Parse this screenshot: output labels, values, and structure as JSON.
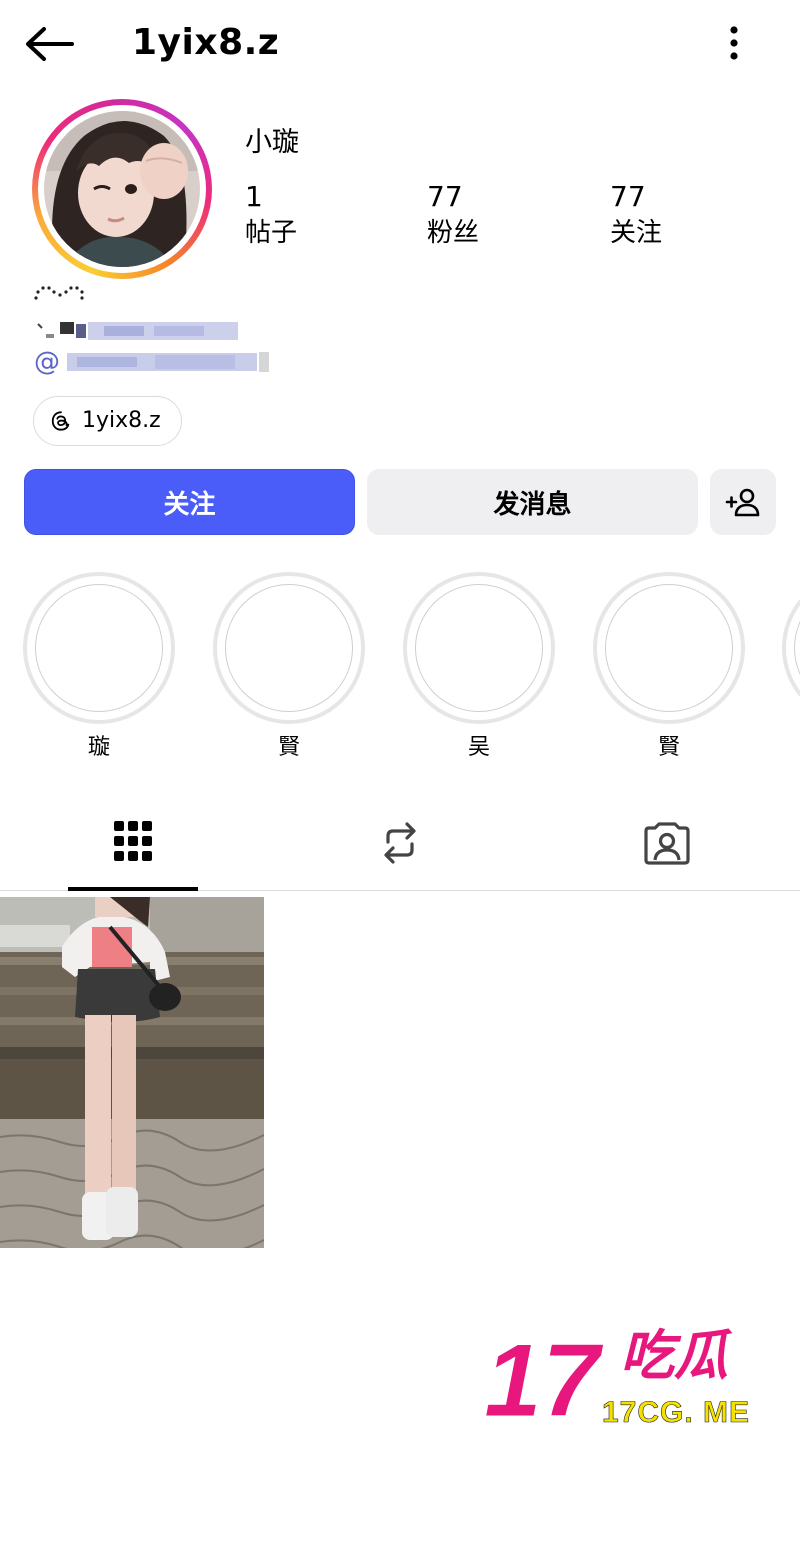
{
  "header": {
    "username": "1yix8.z"
  },
  "profile": {
    "display_name": "小璇",
    "stats": {
      "posts_count": "1",
      "posts_label": "帖子",
      "followers_count": "77",
      "followers_label": "粉丝",
      "following_count": "77",
      "following_label": "关注"
    },
    "bio_mention_prefix": "@",
    "threads_handle": "1yix8.z"
  },
  "actions": {
    "follow_label": "关注",
    "message_label": "发消息"
  },
  "highlights": [
    {
      "label": "璇"
    },
    {
      "label": "賢"
    },
    {
      "label": "吴"
    },
    {
      "label": "賢"
    }
  ],
  "tabs": [
    {
      "icon": "grid-icon",
      "selected": true
    },
    {
      "icon": "reels-repost-icon",
      "selected": false
    },
    {
      "icon": "tagged-person-icon",
      "selected": false
    }
  ],
  "posts": [
    {
      "icon": "photo-thumbnail"
    }
  ],
  "watermark": {
    "number": "17",
    "chars": "吃瓜",
    "site": "17CG. ME"
  },
  "colors": {
    "follow_button": "#4a5df9",
    "secondary_button": "#efeff2",
    "watermark_pink": "#e8177d",
    "watermark_yellow": "#f5e100"
  }
}
